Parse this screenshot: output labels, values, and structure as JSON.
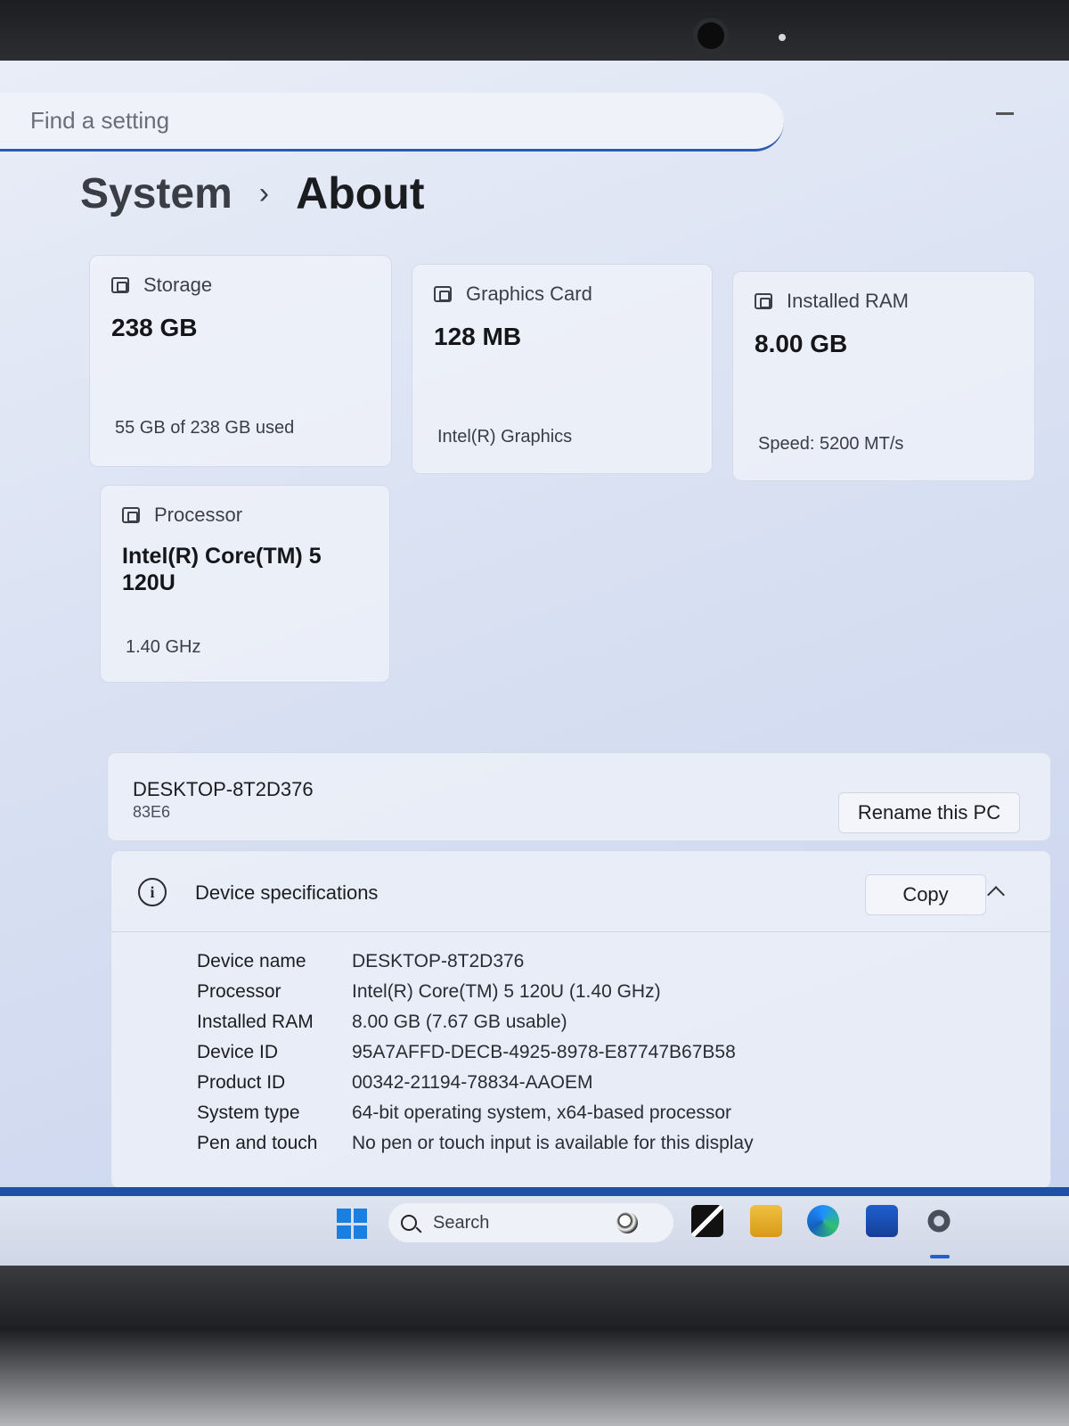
{
  "search": {
    "placeholder": "Find a setting"
  },
  "breadcrumb": {
    "parent": "System",
    "separator": "›",
    "current": "About"
  },
  "cards": {
    "storage": {
      "title": "Storage",
      "value": "238 GB",
      "sub": "55 GB of 238 GB used",
      "icon": "storage-icon"
    },
    "graphics": {
      "title": "Graphics Card",
      "value": "128 MB",
      "sub": "Intel(R) Graphics",
      "icon": "graphics-card-icon"
    },
    "ram": {
      "title": "Installed RAM",
      "value": "8.00 GB",
      "sub": "Speed: 5200 MT/s",
      "icon": "ram-icon"
    },
    "processor": {
      "title": "Processor",
      "value": "Intel(R) Core(TM) 5 120U",
      "sub": "1.40 GHz",
      "icon": "processor-icon"
    }
  },
  "pc": {
    "name": "DESKTOP-8T2D376",
    "model": "83E6",
    "rename_label": "Rename this PC"
  },
  "specs": {
    "title": "Device specifications",
    "copy_label": "Copy",
    "rows": [
      {
        "label": "Device name",
        "value": "DESKTOP-8T2D376"
      },
      {
        "label": "Processor",
        "value": "Intel(R) Core(TM) 5 120U (1.40 GHz)"
      },
      {
        "label": "Installed RAM",
        "value": "8.00 GB (7.67 GB usable)"
      },
      {
        "label": "Device ID",
        "value": "95A7AFFD-DECB-4925-8978-E87747B67B58"
      },
      {
        "label": "Product ID",
        "value": "00342-21194-78834-AAOEM"
      },
      {
        "label": "System type",
        "value": "64-bit operating system, x64-based processor"
      },
      {
        "label": "Pen and touch",
        "value": "No pen or touch input is available for this display"
      }
    ]
  },
  "taskbar": {
    "search_label": "Search"
  },
  "colors": {
    "accent": "#1f5fd0",
    "windows_blue": "#1a7fe0"
  }
}
